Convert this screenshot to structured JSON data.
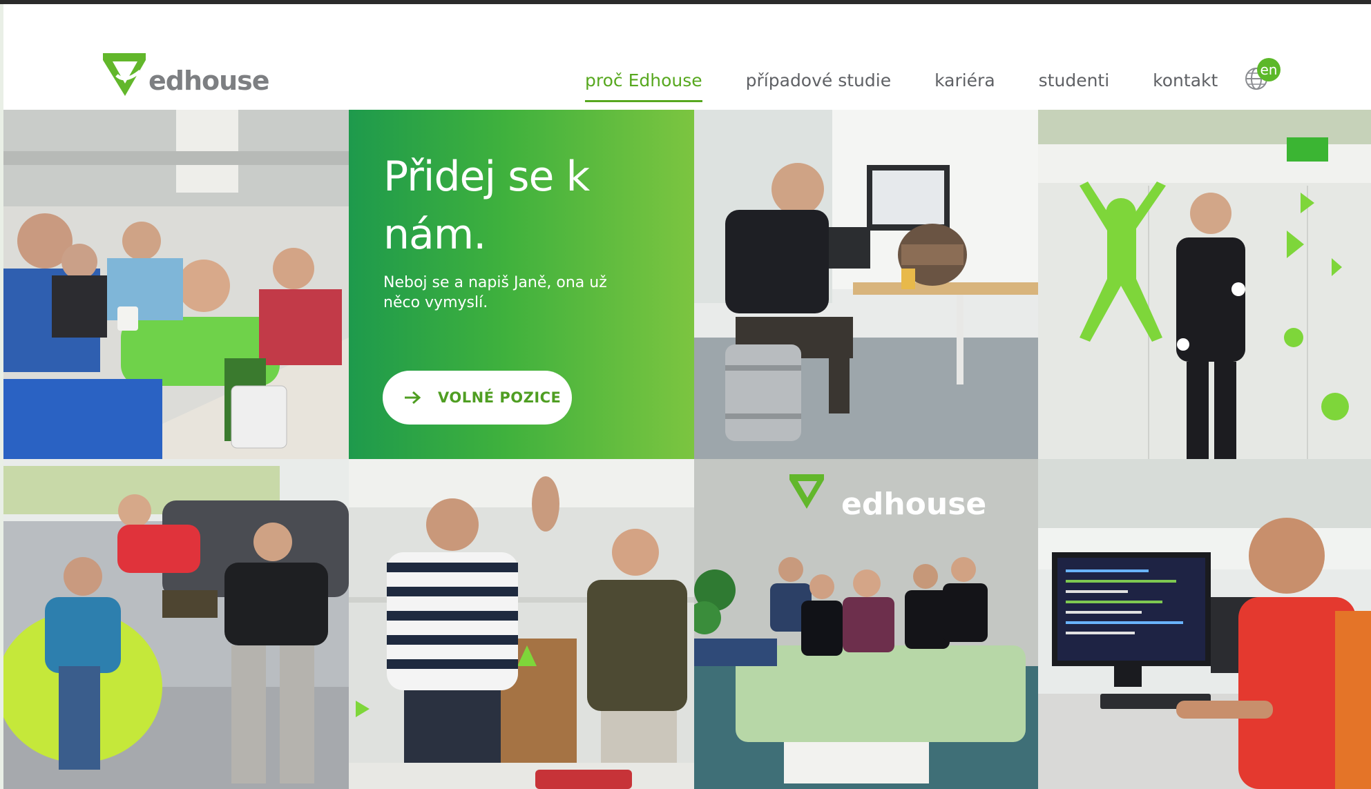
{
  "header": {
    "logo_text": "edhouse",
    "nav": [
      {
        "label": "proč Edhouse",
        "active": true
      },
      {
        "label": "případové studie",
        "active": false
      },
      {
        "label": "kariéra",
        "active": false
      },
      {
        "label": "studenti",
        "active": false
      },
      {
        "label": "kontakt",
        "active": false
      }
    ],
    "language": {
      "label": "en",
      "icon": "globe-icon"
    }
  },
  "promo": {
    "title": "Přidej se k nám.",
    "subtitle": "Neboj se a napiš Janě, ona už něco vymyslí.",
    "button_label": "VOLNÉ POZICE",
    "button_icon": "arrow-right-icon"
  },
  "photo_tiles": [
    {
      "name": "photo-meeting-room"
    },
    {
      "name": "photo-man-on-keg-desk"
    },
    {
      "name": "photo-juggler-green-wall"
    },
    {
      "name": "photo-lounge-beanbag"
    },
    {
      "name": "photo-high-five"
    },
    {
      "name": "photo-team-on-sofa"
    },
    {
      "name": "photo-developer-at-computer"
    }
  ],
  "wall_logo_text": "edhouse",
  "colors": {
    "brand_green": "#57a81f",
    "promo_gradient_start": "#1e9a4c",
    "promo_gradient_end": "#7cc540",
    "nav_text": "#5f6165"
  }
}
